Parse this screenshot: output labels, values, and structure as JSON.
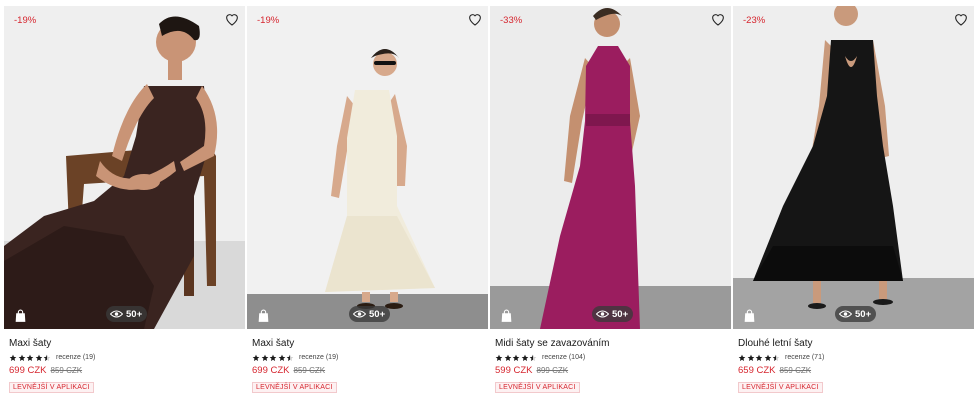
{
  "products": [
    {
      "discount": "-19%",
      "views": "50+",
      "name": "Maxi šaty",
      "reviews": "recenze (19)",
      "price": "699 CZK",
      "old_price": "859 CZK",
      "app_badge": "LEVNĚJŠÍ V APLIKACI",
      "rating": 4.5
    },
    {
      "discount": "-19%",
      "views": "50+",
      "name": "Maxi šaty",
      "reviews": "recenze (19)",
      "price": "699 CZK",
      "old_price": "859 CZK",
      "app_badge": "LEVNĚJŠÍ V APLIKACI",
      "rating": 4.5
    },
    {
      "discount": "-33%",
      "views": "50+",
      "name": "Midi šaty se zavazováním",
      "reviews": "recenze (104)",
      "price": "599 CZK",
      "old_price": "899 CZK",
      "app_badge": "LEVNĚJŠÍ V APLIKACI",
      "rating": 4.5
    },
    {
      "discount": "-23%",
      "views": "50+",
      "name": "Dlouhé letní šaty",
      "reviews": "recenze (71)",
      "price": "659 CZK",
      "old_price": "859 CZK",
      "app_badge": "LEVNĚJŠÍ V APLIKACI",
      "rating": 4.5
    }
  ],
  "icons": {
    "wishlist": "heart-icon",
    "bag": "shopping-bag-icon",
    "views": "eye-icon",
    "star": "star-icon"
  },
  "colors": {
    "sale_red": "#d6262f",
    "dress_1": "#3a2420",
    "dress_2": "#f1ecdc",
    "dress_3": "#9b1d5f",
    "dress_4": "#151515"
  }
}
